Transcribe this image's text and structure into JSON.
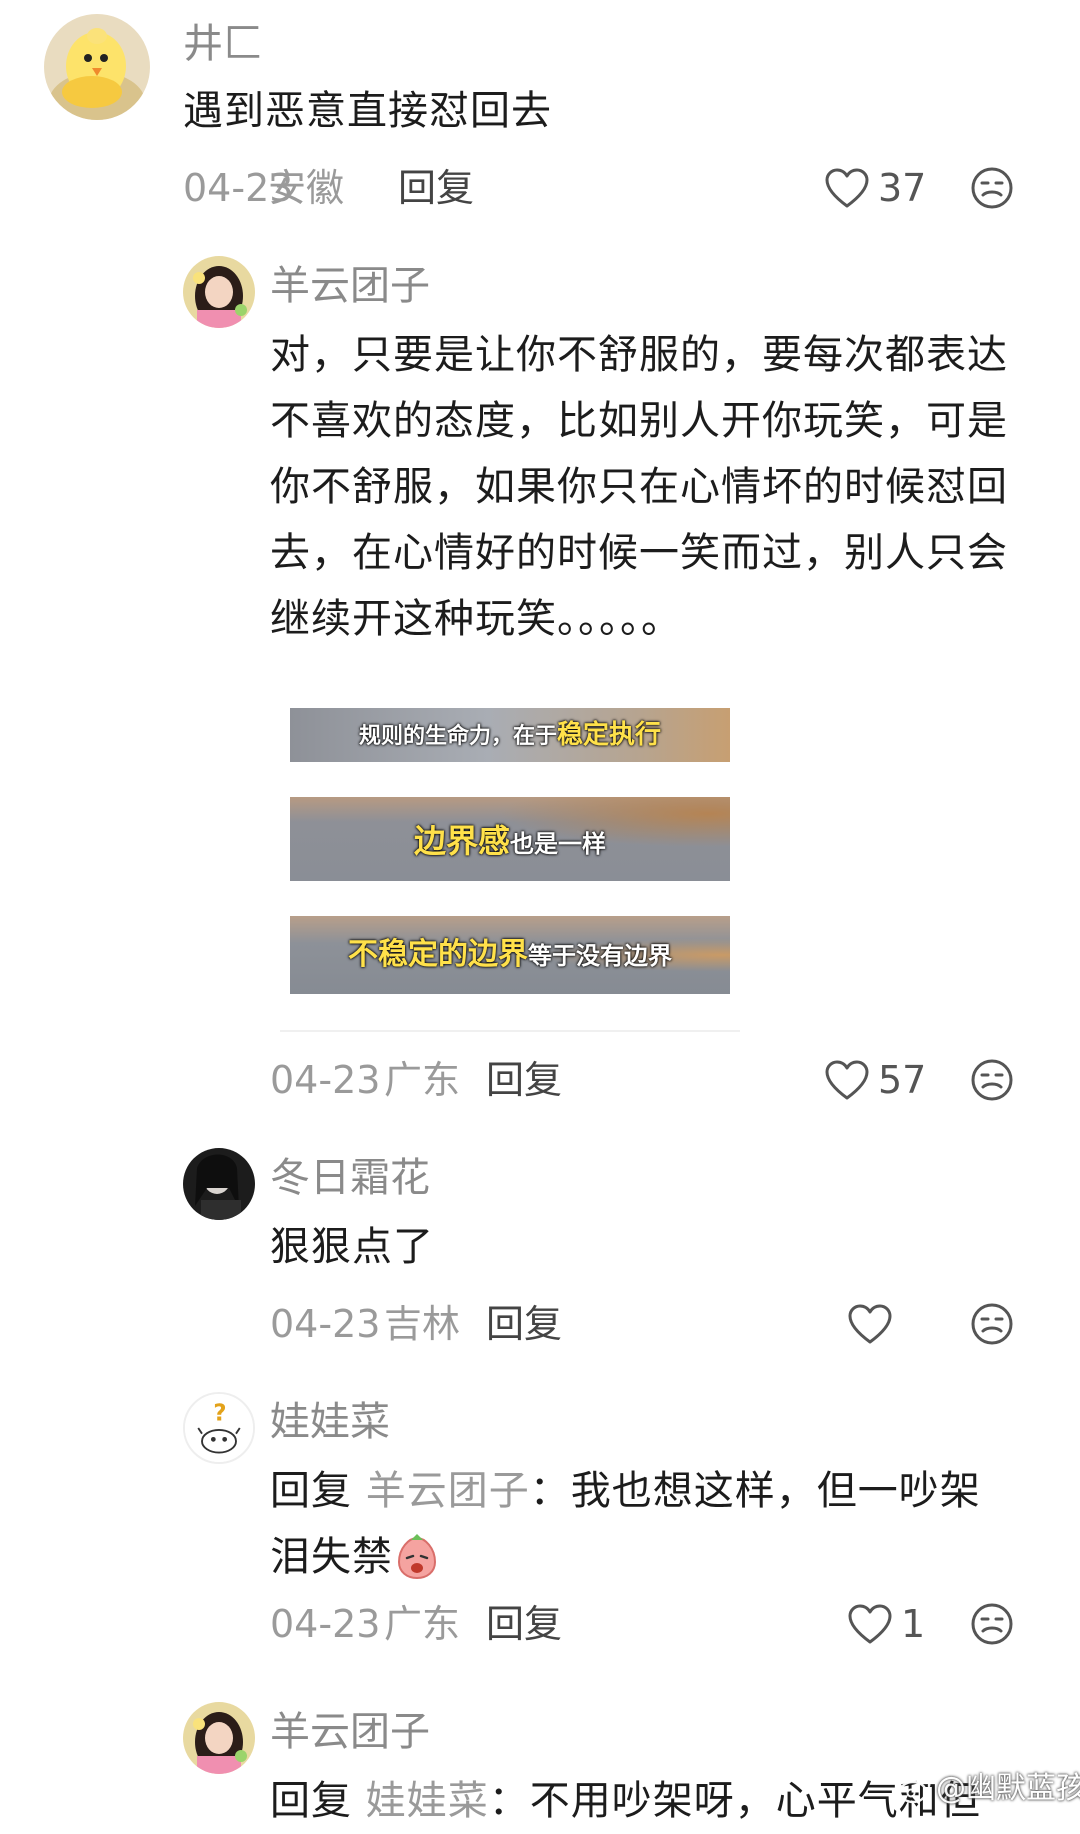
{
  "comments": [
    {
      "username": "井匚",
      "text": "遇到恶意直接怼回去",
      "date": "04-23",
      "location": "安徽",
      "reply_label": "回复",
      "likes": "37"
    },
    {
      "username": "羊云团子",
      "text_lines": [
        "对，只要是让你不舒服的，要每次都表达",
        "不喜欢的态度，比如别人开你玩笑，可是",
        "你不舒服，如果你只在心情坏的时候怼回",
        "去，在心情好的时候一笑而过，别人只会",
        "继续开这种玩笑。。。。。"
      ],
      "image_captions": [
        {
          "white_a": "规则的生命力，在于",
          "yellow": "稳定执行"
        },
        {
          "yellow": "边界感",
          "white_b": "也是一样"
        },
        {
          "yellow": "不稳定的边界",
          "white_b": "等于没有边界"
        }
      ],
      "date": "04-23",
      "location": "广东",
      "reply_label": "回复",
      "likes": "57"
    },
    {
      "username": "冬日霜花",
      "text": "狠狠点了",
      "date": "04-23",
      "location": "吉林",
      "reply_label": "回复",
      "likes": ""
    },
    {
      "username": "娃娃菜",
      "reply_prefix": "回复",
      "reply_to": "羊云团子",
      "text_line1": "：我也想这样，但一吵架",
      "text_line2": "泪失禁",
      "date": "04-23",
      "location": "广东",
      "reply_label": "回复",
      "likes": "1"
    },
    {
      "username": "羊云团子",
      "reply_prefix": "回复",
      "reply_to": "娃娃菜",
      "text_line1": "：不用吵架呀，心平气和但"
    }
  ],
  "watermark": "@幽默蓝孩",
  "icons": {
    "like": "heart-outline-icon",
    "dislike": "meh-face-icon"
  },
  "colors": {
    "username": "#8a8a8a",
    "meta": "#9a9a9a",
    "caption_yellow": "#ffe14a"
  }
}
